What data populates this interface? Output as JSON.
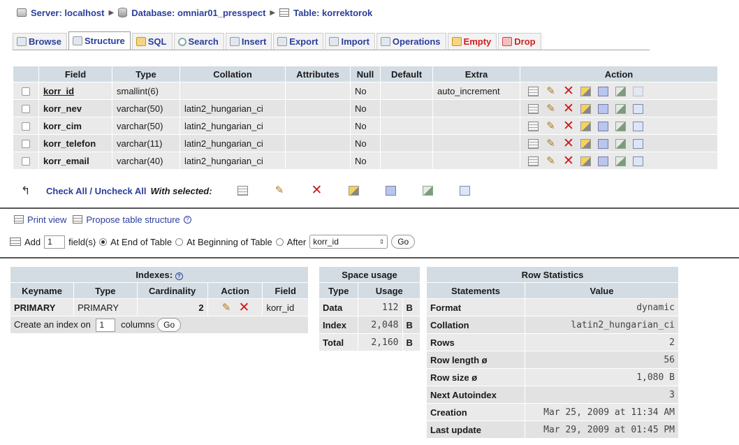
{
  "breadcrumb": {
    "server_label": "Server: localhost",
    "database_label": "Database: omniar01_presspect",
    "table_label": "Table: korrektorok"
  },
  "tabs": [
    {
      "label": "Browse",
      "icon": "browse-icon"
    },
    {
      "label": "Structure",
      "icon": "structure-icon",
      "active": true
    },
    {
      "label": "SQL",
      "icon": "sql-icon"
    },
    {
      "label": "Search",
      "icon": "search-icon"
    },
    {
      "label": "Insert",
      "icon": "insert-icon"
    },
    {
      "label": "Export",
      "icon": "export-icon"
    },
    {
      "label": "Import",
      "icon": "import-icon"
    },
    {
      "label": "Operations",
      "icon": "operations-icon"
    },
    {
      "label": "Empty",
      "icon": "empty-icon",
      "danger": true
    },
    {
      "label": "Drop",
      "icon": "drop-icon",
      "danger": true
    }
  ],
  "structure": {
    "headers": {
      "field": "Field",
      "type": "Type",
      "collation": "Collation",
      "attributes": "Attributes",
      "null": "Null",
      "default": "Default",
      "extra": "Extra",
      "action": "Action"
    },
    "rows": [
      {
        "field": "korr_id",
        "type": "smallint(6)",
        "collation": "",
        "attributes": "",
        "null": "No",
        "default": "",
        "extra": "auto_increment"
      },
      {
        "field": "korr_nev",
        "type": "varchar(50)",
        "collation": "latin2_hungarian_ci",
        "attributes": "",
        "null": "No",
        "default": "",
        "extra": ""
      },
      {
        "field": "korr_cim",
        "type": "varchar(50)",
        "collation": "latin2_hungarian_ci",
        "attributes": "",
        "null": "No",
        "default": "",
        "extra": ""
      },
      {
        "field": "korr_telefon",
        "type": "varchar(11)",
        "collation": "latin2_hungarian_ci",
        "attributes": "",
        "null": "No",
        "default": "",
        "extra": ""
      },
      {
        "field": "korr_email",
        "type": "varchar(40)",
        "collation": "latin2_hungarian_ci",
        "attributes": "",
        "null": "No",
        "default": "",
        "extra": ""
      }
    ],
    "check_all_label": "Check All / Uncheck All",
    "with_selected_label": "With selected:"
  },
  "links": {
    "print_view": "Print view",
    "propose_structure": "Propose table structure"
  },
  "add_fields": {
    "add_label": "Add",
    "count": "1",
    "fields_label": "field(s)",
    "at_end_label": "At End of Table",
    "at_beginning_label": "At Beginning of Table",
    "after_label": "After",
    "after_value": "korr_id",
    "go_label": "Go"
  },
  "indexes": {
    "caption": "Indexes:",
    "headers": {
      "keyname": "Keyname",
      "type": "Type",
      "cardinality": "Cardinality",
      "action": "Action",
      "field": "Field"
    },
    "rows": [
      {
        "keyname": "PRIMARY",
        "type": "PRIMARY",
        "cardinality": "2",
        "field": "korr_id"
      }
    ],
    "create_prefix": "Create an index on",
    "create_count": "1",
    "create_suffix": "columns",
    "go_label": "Go"
  },
  "space_usage": {
    "caption": "Space usage",
    "headers": {
      "type": "Type",
      "usage": "Usage"
    },
    "rows": [
      {
        "type": "Data",
        "value": "112",
        "unit": "B"
      },
      {
        "type": "Index",
        "value": "2,048",
        "unit": "B"
      },
      {
        "type": "Total",
        "value": "2,160",
        "unit": "B"
      }
    ]
  },
  "row_statistics": {
    "caption": "Row Statistics",
    "headers": {
      "statements": "Statements",
      "value": "Value"
    },
    "rows": [
      {
        "label": "Format",
        "value": "dynamic"
      },
      {
        "label": "Collation",
        "value": "latin2_hungarian_ci"
      },
      {
        "label": "Rows",
        "value": "2"
      },
      {
        "label": "Row length ø",
        "value": "56"
      },
      {
        "label": "Row size ø",
        "value": "1,080 B"
      },
      {
        "label": "Next Autoindex",
        "value": "3"
      },
      {
        "label": "Creation",
        "value": "Mar 25, 2009 at 11:34 AM"
      },
      {
        "label": "Last update",
        "value": "Mar 29, 2009 at 01:45 PM"
      }
    ]
  },
  "colors": {
    "link": "#2a3e9c",
    "danger": "#d02020",
    "header_bg": "#d3dce3",
    "row_bg": "#eaeaea"
  }
}
